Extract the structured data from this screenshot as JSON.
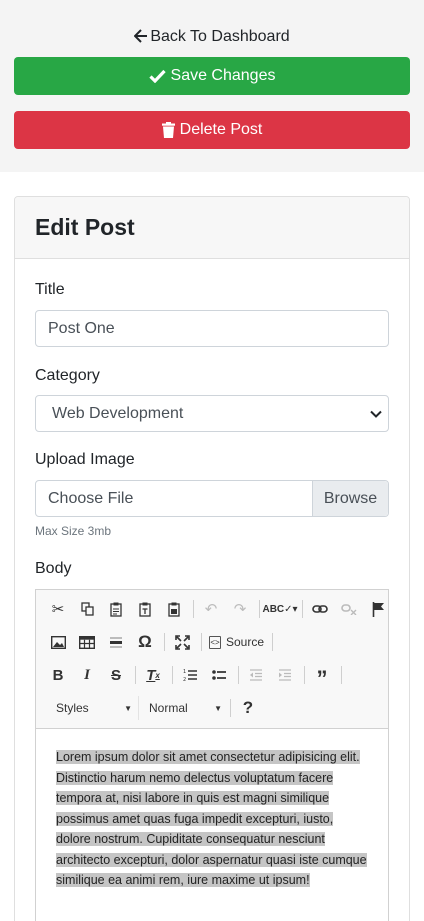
{
  "nav": {
    "back_label": "Back To Dashboard"
  },
  "actions": {
    "save_label": "Save Changes",
    "delete_label": "Delete Post"
  },
  "card": {
    "title": "Edit Post"
  },
  "form": {
    "title_label": "Title",
    "title_value": "Post One",
    "category_label": "Category",
    "category_value": "Web Development",
    "image_label": "Upload Image",
    "file_placeholder": "Choose File",
    "browse_label": "Browse",
    "image_hint": "Max Size 3mb",
    "body_label": "Body"
  },
  "editor": {
    "source_label": "Source",
    "styles_label": "Styles",
    "format_label": "Normal",
    "help_label": "?",
    "body_text": "Lorem ipsum dolor sit amet consectetur adipisicing elit. Distinctio harum nemo delectus voluptatum facere tempora at, nisi labore in quis est magni similique possimus amet quas fuga impedit excepturi, iusto, dolore nostrum. Cupiditate consequatur nesciunt architecto excepturi, dolor aspernatur quasi iste cumque similique ea animi rem, iure maxime ut ipsum!"
  },
  "colors": {
    "save": "#28a745",
    "delete": "#dc3545"
  }
}
